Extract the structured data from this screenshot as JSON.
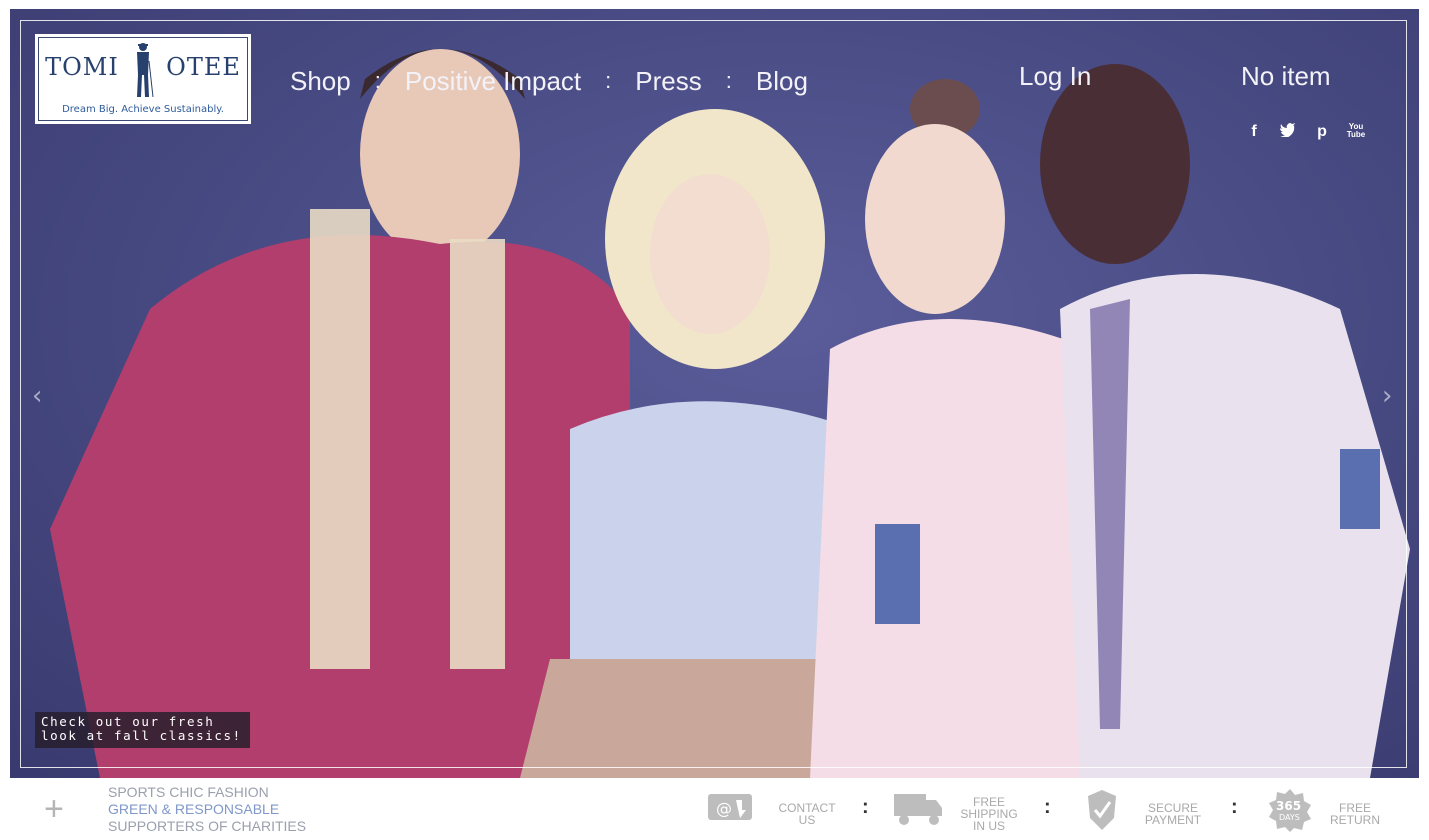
{
  "brand": {
    "name_left": "TOMI",
    "name_right": "OTEE",
    "tagline": "Dream Big. Achieve Sustainably."
  },
  "nav": {
    "items": [
      "Shop",
      "Positive Impact",
      "Press",
      "Blog"
    ],
    "separator": ":",
    "login": "Log In",
    "cart": "No item"
  },
  "social": [
    {
      "icon": "facebook-icon",
      "glyph": "f"
    },
    {
      "icon": "twitter-icon",
      "glyph": "t"
    },
    {
      "icon": "pinterest-icon",
      "glyph": "p"
    },
    {
      "icon": "youtube-icon",
      "glyph": "You\nTube"
    }
  ],
  "hero": {
    "caption_line1": "Check out our fresh",
    "caption_line2": "look at fall classics!",
    "prev_arrow": "‹",
    "next_arrow": "›"
  },
  "footer": {
    "plus": "+",
    "tags": [
      {
        "text": "SPORTS CHIC FASHION",
        "color": "#9aa0ad"
      },
      {
        "text": "GREEN & RESPONSABLE",
        "color": "#7f97c9"
      },
      {
        "text": "SUPPORTERS OF CHARITIES",
        "color": "#9aa0ad"
      }
    ],
    "features": [
      {
        "icon": "contact-icon",
        "line1": "CONTACT",
        "line2": "US"
      },
      {
        "icon": "truck-icon",
        "line1": "FREE",
        "line2": "SHIPPING",
        "line3": "IN US"
      },
      {
        "icon": "secure-shield-icon",
        "line1": "SECURE",
        "line2": "PAYMENT"
      },
      {
        "icon": "365-days-badge-icon",
        "line1": "FREE",
        "line2": "RETURN",
        "badge": "365 DAYS"
      }
    ],
    "separator": ":"
  },
  "colors": {
    "hero_bg": "#45477f",
    "logo_text": "#27406e",
    "tag_accent": "#7f97c9"
  }
}
